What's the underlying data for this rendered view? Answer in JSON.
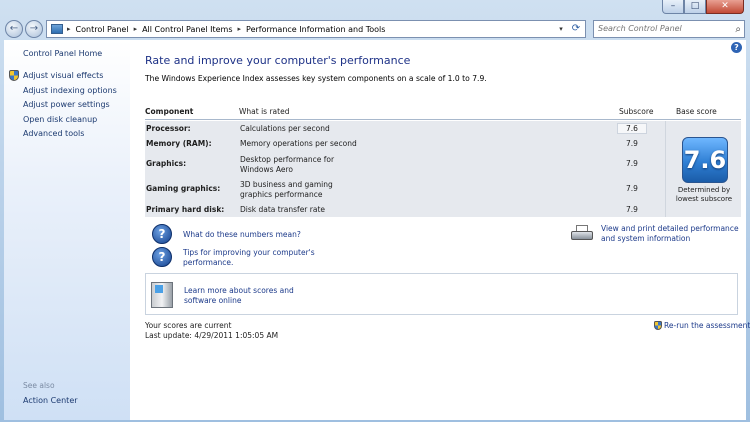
{
  "window": {
    "minimize": "–",
    "maximize": "□",
    "close": "✕"
  },
  "nav": {
    "back": "←",
    "forward": "→"
  },
  "address": {
    "crumbs": [
      "Control Panel",
      "All Control Panel Items",
      "Performance Information and Tools"
    ],
    "separator": "▸"
  },
  "search": {
    "placeholder": "Search Control Panel"
  },
  "sidebar": {
    "home": "Control Panel Home",
    "links": [
      {
        "label": "Adjust visual effects",
        "shield": true
      },
      {
        "label": "Adjust indexing options",
        "shield": false
      },
      {
        "label": "Adjust power settings",
        "shield": false
      },
      {
        "label": "Open disk cleanup",
        "shield": false
      },
      {
        "label": "Advanced tools",
        "shield": false
      }
    ],
    "see_also": "See also",
    "action_center": "Action Center"
  },
  "main": {
    "help": "?",
    "heading": "Rate and improve your computer's performance",
    "intro": "The Windows Experience Index assesses key system components on a scale of 1.0 to 7.9.",
    "columns": {
      "component": "Component",
      "what": "What is rated",
      "subscore": "Subscore",
      "base": "Base score"
    },
    "rows": [
      {
        "component": "Processor:",
        "what": "Calculations per second",
        "subscore": "7.6"
      },
      {
        "component": "Memory (RAM):",
        "what": "Memory operations per second",
        "subscore": "7.9"
      },
      {
        "component": "Graphics:",
        "what": "Desktop performance for Windows Aero",
        "subscore": "7.9"
      },
      {
        "component": "Gaming graphics:",
        "what": "3D business and gaming graphics performance",
        "subscore": "7.9"
      },
      {
        "component": "Primary hard disk:",
        "what": "Disk data transfer rate",
        "subscore": "7.9"
      }
    ],
    "base_score": "7.6",
    "base_caption": "Determined by lowest subscore",
    "links": {
      "what_mean": "What do these numbers mean?",
      "tips": "Tips for improving your computer's performance.",
      "print": "View and print detailed performance and system information",
      "learn": "Learn more about scores and software online"
    },
    "status": "Your scores are current",
    "last_update": "Last update: 4/29/2011 1:05:05 AM",
    "rerun": "Re-run the assessment"
  }
}
